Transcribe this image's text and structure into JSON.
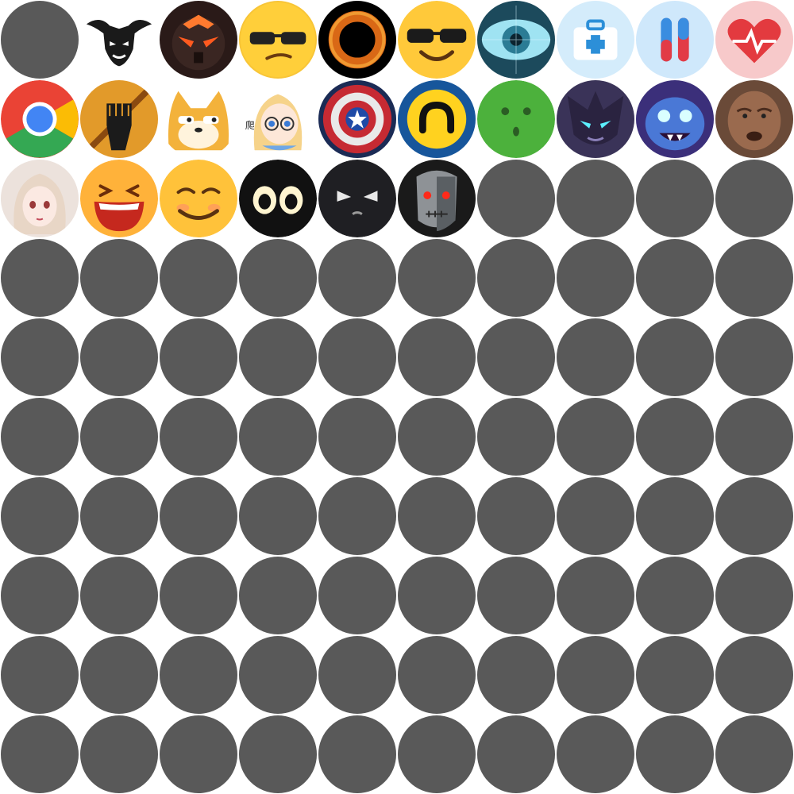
{
  "placeholder_color": "#595959",
  "background_color": "#ffffff",
  "avatars": [
    {
      "icon": "empty-avatar-placeholder",
      "filled": false
    },
    {
      "icon": "bull-head-logo-icon",
      "filled": true
    },
    {
      "icon": "dark-robot-mask-icon",
      "filled": true
    },
    {
      "icon": "sunglasses-emoji-unamused-icon",
      "filled": true
    },
    {
      "icon": "black-hole-ring-icon",
      "filled": true
    },
    {
      "icon": "sunglasses-emoji-smiling-icon",
      "filled": true
    },
    {
      "icon": "digital-eye-icon",
      "filled": true
    },
    {
      "icon": "first-aid-kit-icon",
      "filled": true
    },
    {
      "icon": "medicine-capsule-icon",
      "filled": true
    },
    {
      "icon": "heartbeat-icon",
      "filled": true
    },
    {
      "icon": "chrome-browser-icon",
      "filled": true
    },
    {
      "icon": "raised-fist-icon",
      "filled": true
    },
    {
      "icon": "shiba-doge-icon",
      "filled": true
    },
    {
      "icon": "anime-girl-glasses-icon",
      "filled": true,
      "caption": "爬"
    },
    {
      "icon": "captain-shield-icon",
      "filled": true
    },
    {
      "icon": "yellow-arch-logo-icon",
      "filled": true
    },
    {
      "icon": "green-surprised-face-icon",
      "filled": true
    },
    {
      "icon": "dark-witch-character-icon",
      "filled": true
    },
    {
      "icon": "blue-monster-character-icon",
      "filled": true
    },
    {
      "icon": "elderly-man-portrait-icon",
      "filled": true
    },
    {
      "icon": "anime-girl-portrait-icon",
      "filled": true
    },
    {
      "icon": "laughing-emoji-icon",
      "filled": true
    },
    {
      "icon": "smirking-emoji-icon",
      "filled": true
    },
    {
      "icon": "big-eyes-face-icon",
      "filled": true
    },
    {
      "icon": "angry-black-face-icon",
      "filled": true
    },
    {
      "icon": "terminator-face-icon",
      "filled": true
    }
  ],
  "total_slots": 100
}
